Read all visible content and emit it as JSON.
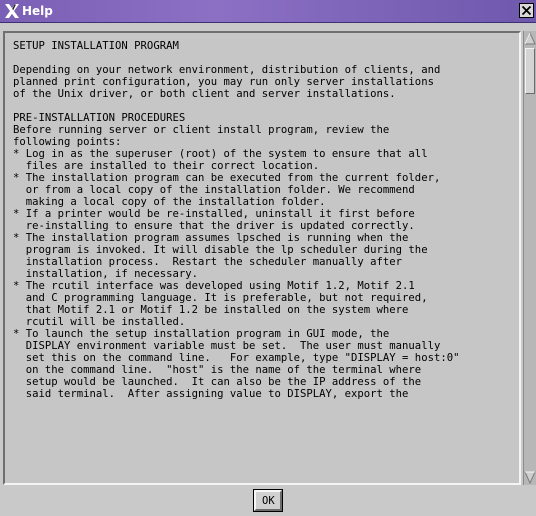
{
  "window": {
    "title": "Help"
  },
  "content": {
    "lines": [
      "SETUP INSTALLATION PROGRAM",
      "",
      "Depending on your network environment, distribution of clients, and",
      "planned print configuration, you may run only server installations",
      "of the Unix driver, or both client and server installations.",
      "",
      "PRE-INSTALLATION PROCEDURES",
      "Before running server or client install program, review the",
      "following points:",
      "* Log in as the superuser (root) of the system to ensure that all",
      "  files are installed to their correct location.",
      "* The installation program can be executed from the current folder,",
      "  or from a local copy of the installation folder. We recommend",
      "  making a local copy of the installation folder.",
      "* If a printer would be re-installed, uninstall it first before",
      "  re-installing to ensure that the driver is updated correctly.",
      "* The installation program assumes lpsched is running when the",
      "  program is invoked. It will disable the lp scheduler during the",
      "  installation process.  Restart the scheduler manually after",
      "  installation, if necessary.",
      "* The rcutil interface was developed using Motif 1.2, Motif 2.1",
      "  and C programming language. It is preferable, but not required,",
      "  that Motif 2.1 or Motif 1.2 be installed on the system where",
      "  rcutil will be installed.",
      "* To launch the setup installation program in GUI mode, the",
      "  DISPLAY environment variable must be set.  The user must manually",
      "  set this on the command line.   For example, type \"DISPLAY = host:0\"",
      "  on the command line.  \"host\" is the name of the terminal where",
      "  setup would be launched.  It can also be the IP address of the",
      "  said terminal.  After assigning value to DISPLAY, export the"
    ]
  },
  "buttons": {
    "ok_label": "OK"
  },
  "icons": {
    "app": "x-logo-icon",
    "close": "close-icon",
    "up": "arrow-up-icon",
    "down": "arrow-down-icon"
  },
  "colors": {
    "titlebar": "#7a5fb5",
    "background": "#c9c9c9",
    "text_area": "#c6c6c6"
  }
}
